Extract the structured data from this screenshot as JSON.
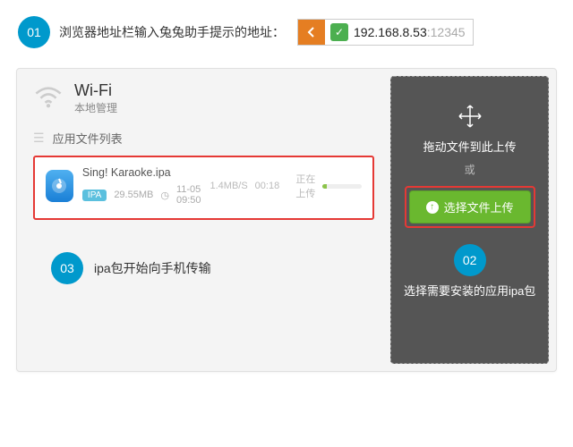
{
  "step1": {
    "num": "01",
    "text": "浏览器地址栏输入兔兔助手提示的地址：",
    "ip": "192.168.8.53",
    "port": ":12345"
  },
  "wifi": {
    "title": "Wi-Fi",
    "sub": "本地管理"
  },
  "list": {
    "heading": "应用文件列表"
  },
  "file": {
    "name": "Sing! Karaoke.ipa",
    "tag": "IPA",
    "size": "29.55MB",
    "time": "11-05 09:50",
    "speed": "1.4MB/S",
    "duration": "00:18",
    "status": "正在上传"
  },
  "step3": {
    "num": "03",
    "text": "ipa包开始向手机传输"
  },
  "drop": {
    "drag": "拖动文件到此上传",
    "or": "或",
    "upload": "选择文件上传"
  },
  "step2": {
    "num": "02",
    "text": "选择需要安装的应用ipa包"
  }
}
